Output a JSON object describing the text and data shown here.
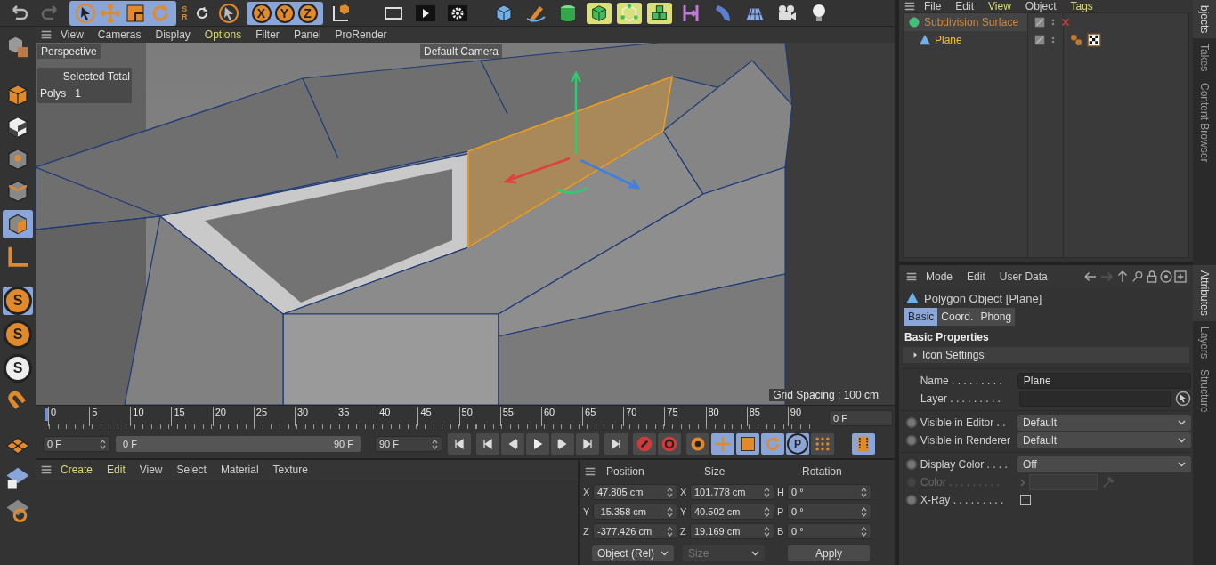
{
  "toolbar": {
    "snap": {
      "top": "S",
      "bottom": "R"
    },
    "axis_locks": [
      {
        "label": "X",
        "selected": true
      },
      {
        "label": "Y",
        "selected": true
      },
      {
        "label": "Z",
        "selected": true
      }
    ]
  },
  "left_tools": {
    "snap_buttons": [
      {
        "label": "S",
        "selected": true
      },
      {
        "label": "S",
        "selected": false
      },
      {
        "label": "S",
        "selected": false
      }
    ]
  },
  "viewport": {
    "menu": [
      {
        "label": "View",
        "highlighted": false
      },
      {
        "label": "Cameras",
        "highlighted": false
      },
      {
        "label": "Display",
        "highlighted": false
      },
      {
        "label": "Options",
        "highlighted": true
      },
      {
        "label": "Filter",
        "highlighted": false
      },
      {
        "label": "Panel",
        "highlighted": false
      },
      {
        "label": "ProRender",
        "highlighted": false
      }
    ],
    "camera_label": "Perspective",
    "hud": {
      "header": "Selected Total",
      "rows": [
        {
          "label": "Polys",
          "value": "1"
        }
      ]
    },
    "camera_name": "Default Camera",
    "grid_spacing": "Grid Spacing : 100 cm"
  },
  "timeline": {
    "ticks": [
      "0",
      "5",
      "10",
      "15",
      "20",
      "25",
      "30",
      "35",
      "40",
      "45",
      "50",
      "55",
      "60",
      "65",
      "70",
      "75",
      "80",
      "85",
      "90"
    ],
    "current_frame": "0 F",
    "start": "0 F",
    "range": {
      "start": "0 F",
      "end": "90 F",
      "level": 1
    },
    "end": "90 F",
    "key_button": "P"
  },
  "material_manager": {
    "menu": [
      {
        "label": "Create",
        "highlighted": true
      },
      {
        "label": "Edit",
        "highlighted": true
      },
      {
        "label": "View",
        "highlighted": false
      },
      {
        "label": "Select",
        "highlighted": false
      },
      {
        "label": "Material",
        "highlighted": false
      },
      {
        "label": "Texture",
        "highlighted": false
      }
    ]
  },
  "coordinates": {
    "columns": [
      "Position",
      "Size",
      "Rotation"
    ],
    "rows": [
      {
        "position_axis": "X",
        "position": "47.805 cm",
        "size_axis": "X",
        "size": "101.778 cm",
        "rotation_axis": "H",
        "rotation": "0 °"
      },
      {
        "position_axis": "Y",
        "position": "-15.358 cm",
        "size_axis": "Y",
        "size": "40.502 cm",
        "rotation_axis": "P",
        "rotation": "0 °"
      },
      {
        "position_axis": "Z",
        "position": "-377.426 cm",
        "size_axis": "Z",
        "size": "19.169 cm",
        "rotation_axis": "B",
        "rotation": "0 °"
      }
    ],
    "mode": "Object (Rel)",
    "size_mode": {
      "value": "Size",
      "disabled": true
    },
    "apply": "Apply"
  },
  "object_manager": {
    "menu": [
      {
        "label": "File",
        "highlighted": false
      },
      {
        "label": "Edit",
        "highlighted": false
      },
      {
        "label": "View",
        "highlighted": true
      },
      {
        "label": "Object",
        "highlighted": false
      },
      {
        "label": "Tags",
        "highlighted": true
      }
    ],
    "objects": [
      {
        "name": "Subdivision Surface",
        "selected": false,
        "children": [
          {
            "name": "Plane",
            "selected": true
          }
        ]
      }
    ]
  },
  "side_tabs_top": [
    {
      "label": "bjects",
      "selected": true
    },
    {
      "label": "Takes",
      "selected": false
    },
    {
      "label": "Content Browser",
      "selected": false
    }
  ],
  "attributes": {
    "menu": [
      {
        "label": "Mode",
        "highlighted": false
      },
      {
        "label": "Edit",
        "highlighted": false
      },
      {
        "label": "User Data",
        "highlighted": false
      }
    ],
    "title": "Polygon Object [Plane]",
    "tabs": [
      {
        "label": "Basic",
        "selected": true
      },
      {
        "label": "Coord.",
        "selected": false
      },
      {
        "label": "Phong",
        "selected": false
      }
    ],
    "section": "Basic Properties",
    "group": {
      "label": "Icon Settings",
      "expanded": false
    },
    "field_groups": [
      [
        {
          "kind": "text",
          "label": "Name . . . . . . . . .",
          "value": "Plane",
          "animatable": false,
          "disabled": false
        },
        {
          "kind": "link",
          "label": "Layer . . . . . . . . .",
          "animatable": false,
          "disabled": false
        }
      ],
      [
        {
          "kind": "select",
          "label": "Visible in Editor . .",
          "value": "Default",
          "animatable": true,
          "disabled": false
        },
        {
          "kind": "select",
          "label": "Visible in Renderer",
          "value": "Default",
          "animatable": true,
          "disabled": false
        }
      ],
      [
        {
          "kind": "select",
          "label": "Display Color . . . .",
          "value": "Off",
          "animatable": true,
          "disabled": false
        },
        {
          "kind": "color",
          "label": "Color . . . . . . . . .",
          "animatable": true,
          "disabled": true
        },
        {
          "kind": "checkbox",
          "label": "X-Ray . . . . . . . . .",
          "checked": false,
          "animatable": true,
          "disabled": false
        }
      ]
    ]
  },
  "side_tabs_bottom": [
    {
      "label": "Attributes",
      "selected": true
    },
    {
      "label": "Layers",
      "selected": false
    },
    {
      "label": "Structure",
      "selected": false
    }
  ]
}
